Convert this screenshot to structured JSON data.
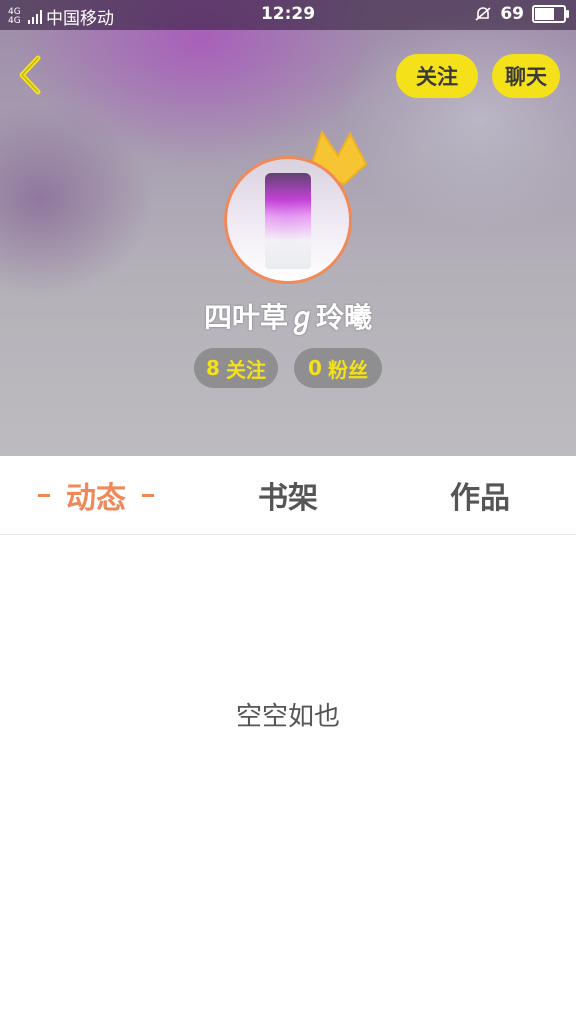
{
  "status_bar": {
    "network_top": "4G",
    "network_bottom": "4G",
    "carrier": "中国移动",
    "time": "12:29",
    "battery": "69"
  },
  "header": {
    "follow_button": "关注",
    "chat_button": "聊天"
  },
  "profile": {
    "username": "四叶草ℊ玲曦",
    "following_count": "8",
    "following_label": "关注",
    "fans_count": "0",
    "fans_label": "粉丝"
  },
  "tabs": [
    {
      "label": "动态",
      "active": true
    },
    {
      "label": "书架",
      "active": false
    },
    {
      "label": "作品",
      "active": false
    }
  ],
  "content": {
    "empty_text": "空空如也"
  },
  "colors": {
    "accent": "#f0895a",
    "button_yellow": "#f5e11a"
  },
  "icons": {
    "back": "chevron-left-icon",
    "crown": "crown-icon",
    "mute": "bell-off-icon"
  }
}
